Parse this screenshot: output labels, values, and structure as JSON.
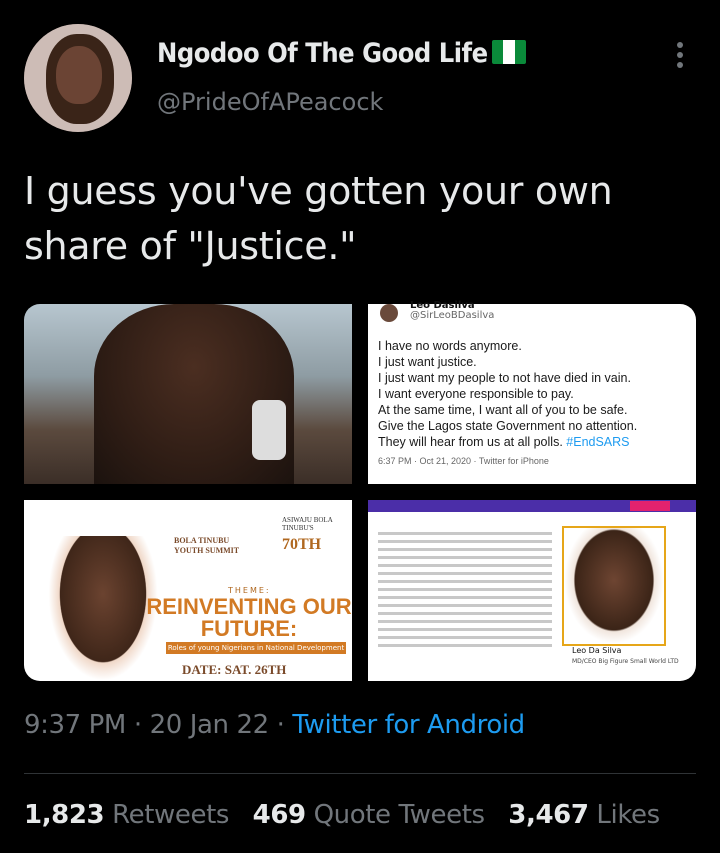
{
  "user": {
    "display_name": "Ngodoo Of The Good Life",
    "handle": "@PrideOfAPeacock",
    "flag_icon": "nigeria-flag-icon"
  },
  "tweet": {
    "text": "I guess you've gotten your own share of \"Justice.\""
  },
  "media": {
    "embedded_tweet": {
      "author_name": "Leo Dasilva",
      "author_handle": "@SirLeoBDasilva",
      "lines": [
        "I have no words anymore.",
        "I just want justice.",
        "I just want my people to not have died in vain.",
        "I want everyone responsible to pay.",
        "At the same time, I want all of you to be safe.",
        "Give the Lagos state Government no attention.",
        "They will hear from us at all polls."
      ],
      "hashtag": "#EndSARS",
      "meta": "6:37 PM · Oct 21, 2020 · Twitter for iPhone"
    },
    "poster": {
      "org_line_1": "BOLA TINUBU",
      "org_line_2": "YOUTH SUMMIT",
      "anniv_line_1": "ASIWAJU BOLA TINUBU'S",
      "anniv_line_2": "70TH",
      "theme_label": "THEME:",
      "headline": "REINVENTING OUR FUTURE:",
      "subline": "Roles of young Nigerians in National Development",
      "date": "DATE: SAT. 26TH"
    },
    "profile_page": {
      "name": "Leo Da Silva",
      "role": "MD/CEO Big Figure Small World LTD"
    }
  },
  "timestamp": {
    "time": "9:37 PM",
    "date": "20 Jan 22",
    "source": "Twitter for Android",
    "separator": "·"
  },
  "stats": {
    "retweets_count": "1,823",
    "retweets_label": "Retweets",
    "quotes_count": "469",
    "quotes_label": "Quote Tweets",
    "likes_count": "3,467",
    "likes_label": "Likes"
  }
}
